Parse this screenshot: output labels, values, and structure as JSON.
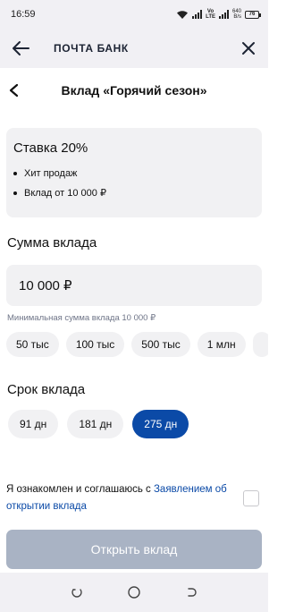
{
  "status_bar": {
    "time": "16:59",
    "network_label": "LTE",
    "speed_value": "640",
    "speed_unit": "B/s",
    "battery": "76"
  },
  "app_header": {
    "title": "ПОЧТА БАНК"
  },
  "page": {
    "title": "Вклад «Горячий сезон»"
  },
  "rate_card": {
    "title": "Ставка 20%",
    "bullets": [
      "Хит продаж",
      "Вклад от 10 000 ₽"
    ]
  },
  "amount": {
    "section_title": "Сумма вклада",
    "value": "10 000 ₽",
    "hint": "Минимальная сумма вклада 10 000 ₽",
    "quick_options": [
      "50 тыс",
      "100 тыс",
      "500 тыс",
      "1 млн"
    ]
  },
  "term": {
    "section_title": "Срок вклада",
    "options": [
      "91 дн",
      "181 дн",
      "275 дн"
    ],
    "selected": "275 дн"
  },
  "agreement": {
    "text": "Я ознакомлен и соглашаюсь с ",
    "link_text": "Заявлением об открытии вклада",
    "checked": false
  },
  "submit": {
    "label": "Открыть вклад"
  },
  "colors": {
    "accent": "#0b4aa7",
    "card_bg": "#f1f1f3",
    "disabled_button": "#a9b3c4"
  },
  "icons": {
    "back_arrow": "arrow-left-icon",
    "close": "close-icon",
    "chevron_back": "chevron-left-icon",
    "nav_recent": "recent-apps-icon",
    "nav_home": "home-icon",
    "nav_back": "back-icon"
  }
}
